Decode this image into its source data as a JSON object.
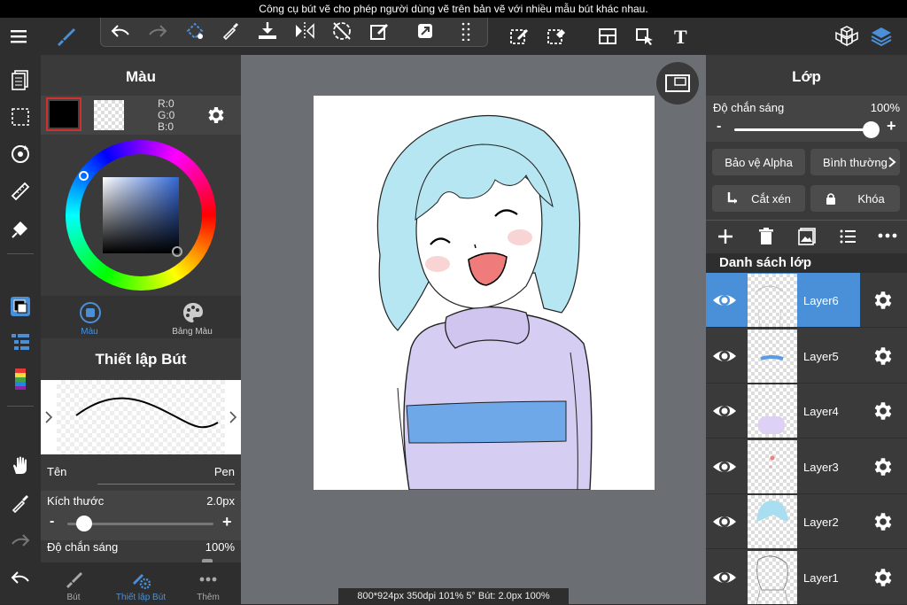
{
  "tooltip": "Công cụ bút vẽ cho phép người dùng vẽ trên bản vẽ với nhiều mẫu bút khác nhau.",
  "color_panel": {
    "title": "Màu",
    "rgb": {
      "r": "R:0",
      "g": "G:0",
      "b": "B:0"
    },
    "tabs": [
      {
        "label": "Màu",
        "icon": "color-square-icon",
        "active": true
      },
      {
        "label": "Bảng Màu",
        "icon": "palette-icon",
        "active": false
      }
    ],
    "primary_color": "#000000"
  },
  "pen_panel": {
    "title": "Thiết lập Bút",
    "name_label": "Tên",
    "name_value": "Pen",
    "size_label": "Kích thước",
    "size_value": "2.0px",
    "size_fraction": 0.1,
    "opacity_label": "Độ chắn sáng",
    "opacity_value": "100%"
  },
  "bottom_tabs": [
    {
      "label": "Bút",
      "icon": "brush-icon",
      "active": false
    },
    {
      "label": "Thiết lập Bút",
      "icon": "brush-settings-icon",
      "active": true
    },
    {
      "label": "Thêm",
      "icon": "more-icon",
      "active": false
    }
  ],
  "status_bar": "800*924px 350dpi 101% 5° Bút: 2.0px 100%",
  "layer_panel": {
    "title": "Lớp",
    "opacity_label": "Độ chắn sáng",
    "opacity_value": "100%",
    "opacity_fraction": 1.0,
    "alpha_protect": "Bảo vệ Alpha",
    "blend_mode": "Bình thường",
    "clipping": "Cắt xén",
    "lock": "Khóa",
    "list_title": "Danh sách lớp",
    "layers": [
      {
        "name": "Layer6",
        "selected": true
      },
      {
        "name": "Layer5",
        "selected": false
      },
      {
        "name": "Layer4",
        "selected": false
      },
      {
        "name": "Layer3",
        "selected": false
      },
      {
        "name": "Layer2",
        "selected": false
      },
      {
        "name": "Layer1",
        "selected": false
      }
    ]
  },
  "colors": {
    "accent": "#4a90d9",
    "panel": "#3a3a3a",
    "canvas_bg": "#6b6e72"
  }
}
